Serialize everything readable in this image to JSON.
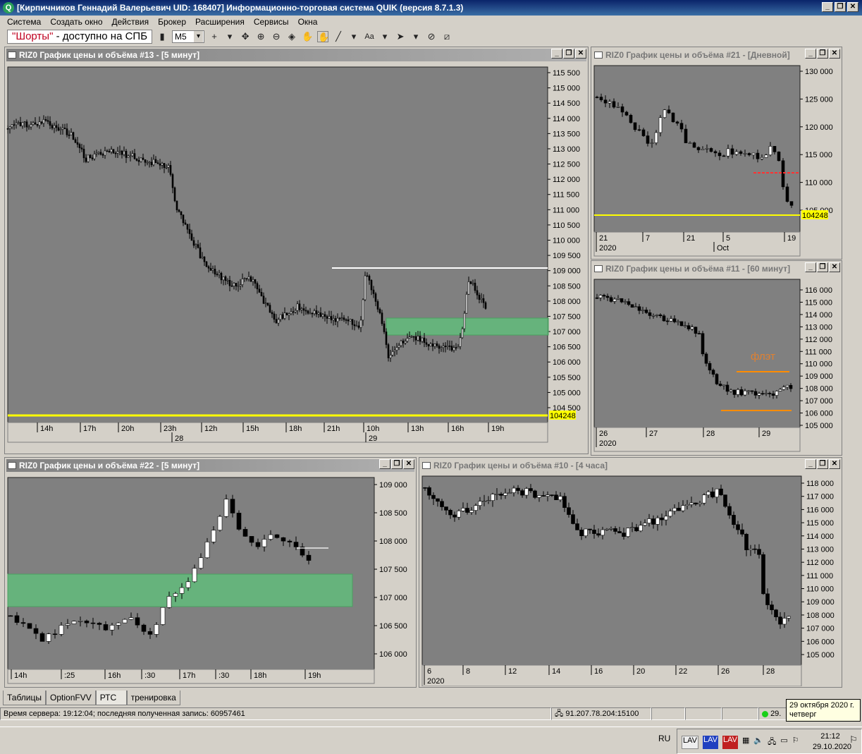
{
  "app": {
    "title": "[Кирпичников Геннадий Валерьевич UID: 168407] Информационно-торговая система QUIK (версия 8.7.1.3)",
    "logo_letter": "Q"
  },
  "menu": [
    "Система",
    "Создать окно",
    "Действия",
    "Брокер",
    "Расширения",
    "Сервисы",
    "Окна"
  ],
  "toolbar": {
    "shorts_quote": "\"Шорты\"",
    "shorts_rest": " - доступно на СПБ",
    "interval": "M5"
  },
  "windows": [
    {
      "id": "w13",
      "title": "RIZ0 График цены и объёма #13 - [5 минут]",
      "active": true,
      "ylabels": [
        "115 500",
        "115 000",
        "114 500",
        "114 000",
        "113 500",
        "113 000",
        "112 500",
        "112 000",
        "111 500",
        "111 000",
        "110 500",
        "110 000",
        "109 500",
        "109 000",
        "108 500",
        "108 000",
        "107 500",
        "107 000",
        "106 500",
        "106 000",
        "105 500",
        "105 000",
        "104 500"
      ],
      "price_tag": "104248",
      "xlabels": [
        "14h",
        "17h",
        "20h",
        "23h",
        "12h",
        "15h",
        "18h",
        "21h",
        "10h",
        "13h",
        "16h",
        "19h"
      ],
      "xdates": [
        "28",
        "29"
      ]
    },
    {
      "id": "w21",
      "title": "RIZ0 График цены и объёма #21 - [Дневной]",
      "active": false,
      "ylabels": [
        "130 000",
        "125 000",
        "120 000",
        "115 000",
        "110 000",
        "105 000"
      ],
      "price_tag": "104248",
      "xlabels": [
        "21",
        "7",
        "21",
        "5",
        "19"
      ],
      "xdates": [
        "2020",
        "Oct"
      ]
    },
    {
      "id": "w11",
      "title": "RIZ0 График цены и объёма #11 - [60 минут]",
      "active": false,
      "ylabels": [
        "116 000",
        "115 000",
        "114 000",
        "113 000",
        "112 000",
        "111 000",
        "110 000",
        "109 000",
        "108 000",
        "107 000",
        "106 000",
        "105 000"
      ],
      "annotation": "флэт",
      "xlabels": [
        "26",
        "27",
        "28",
        "29"
      ],
      "xdates": [
        "2020"
      ]
    },
    {
      "id": "w22",
      "title": "RIZ0 График цены и объёма #22 - [5 минут]",
      "active": true,
      "ylabels": [
        "109 000",
        "108 500",
        "108 000",
        "107 500",
        "107 000",
        "106 500",
        "106 000"
      ],
      "xlabels": [
        "14h",
        ":25",
        "16h",
        ":30",
        "17h",
        ":30",
        "18h",
        "19h"
      ]
    },
    {
      "id": "w10",
      "title": "RIZ0 График цены и объёма #10 - [4 часа]",
      "active": false,
      "ylabels": [
        "118 000",
        "117 000",
        "116 000",
        "115 000",
        "114 000",
        "113 000",
        "112 000",
        "111 000",
        "110 000",
        "109 000",
        "108 000",
        "107 000",
        "106 000",
        "105 000"
      ],
      "xlabels": [
        "6",
        "8",
        "12",
        "14",
        "16",
        "20",
        "22",
        "26",
        "28"
      ],
      "xdates": [
        "2020"
      ]
    }
  ],
  "tabs": [
    "Таблицы",
    "OptionFVV",
    "РТС",
    "тренировка"
  ],
  "selected_tab": "РТС",
  "status": {
    "server": "Время сервера: 19:12:04; последняя полученная запись: 60957461",
    "connection": "91.207.78.204:15100",
    "tail": "29."
  },
  "tooltip": {
    "line1": "29 октября 2020 г.",
    "line2": "четверг"
  },
  "taskbar": {
    "lang": "RU",
    "time": "21:12",
    "date": "29.10.2020"
  },
  "colors": {
    "plot_bg": "#808080",
    "candle": "#000000",
    "level_yellow": "#ffff00",
    "zone_green": "#5fbf7a",
    "level_white": "#ffffff",
    "level_red": "#ff3030",
    "level_orange": "#ff8c00"
  }
}
